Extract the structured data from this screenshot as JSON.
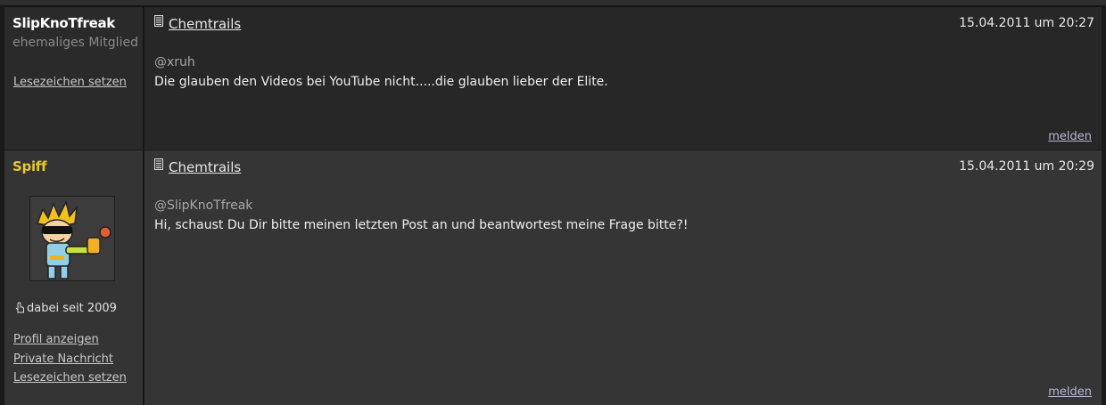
{
  "posts": [
    {
      "username": "SlipKnoTfreak",
      "rank": "ehemaliges Mitglied",
      "links": [
        "Lesezeichen setzen"
      ],
      "thread_title": "Chemtrails",
      "timestamp": "15.04.2011 um 20:27",
      "mention": "@xruh",
      "message": "Die glauben den Videos bei YouTube nicht.....die glauben lieber der Elite.",
      "report_label": "melden"
    },
    {
      "username": "Spiff",
      "member_since": "dabei seit 2009",
      "links": [
        "Profil anzeigen",
        "Private Nachricht",
        "Lesezeichen setzen"
      ],
      "thread_title": "Chemtrails",
      "timestamp": "15.04.2011 um 20:29",
      "mention": "@SlipKnoTfreak",
      "message": "Hi, schaust Du Dir bitte meinen letzten Post an und beantwortest meine Frage bitte?!",
      "report_label": "melden",
      "avatar_icon": "cartoon-avatar-icon"
    }
  ],
  "colors": {
    "guest_username": "#ffffff",
    "member_username": "#e6c82e",
    "post_bg_dark": "#272727",
    "post_bg_light": "#353535"
  }
}
